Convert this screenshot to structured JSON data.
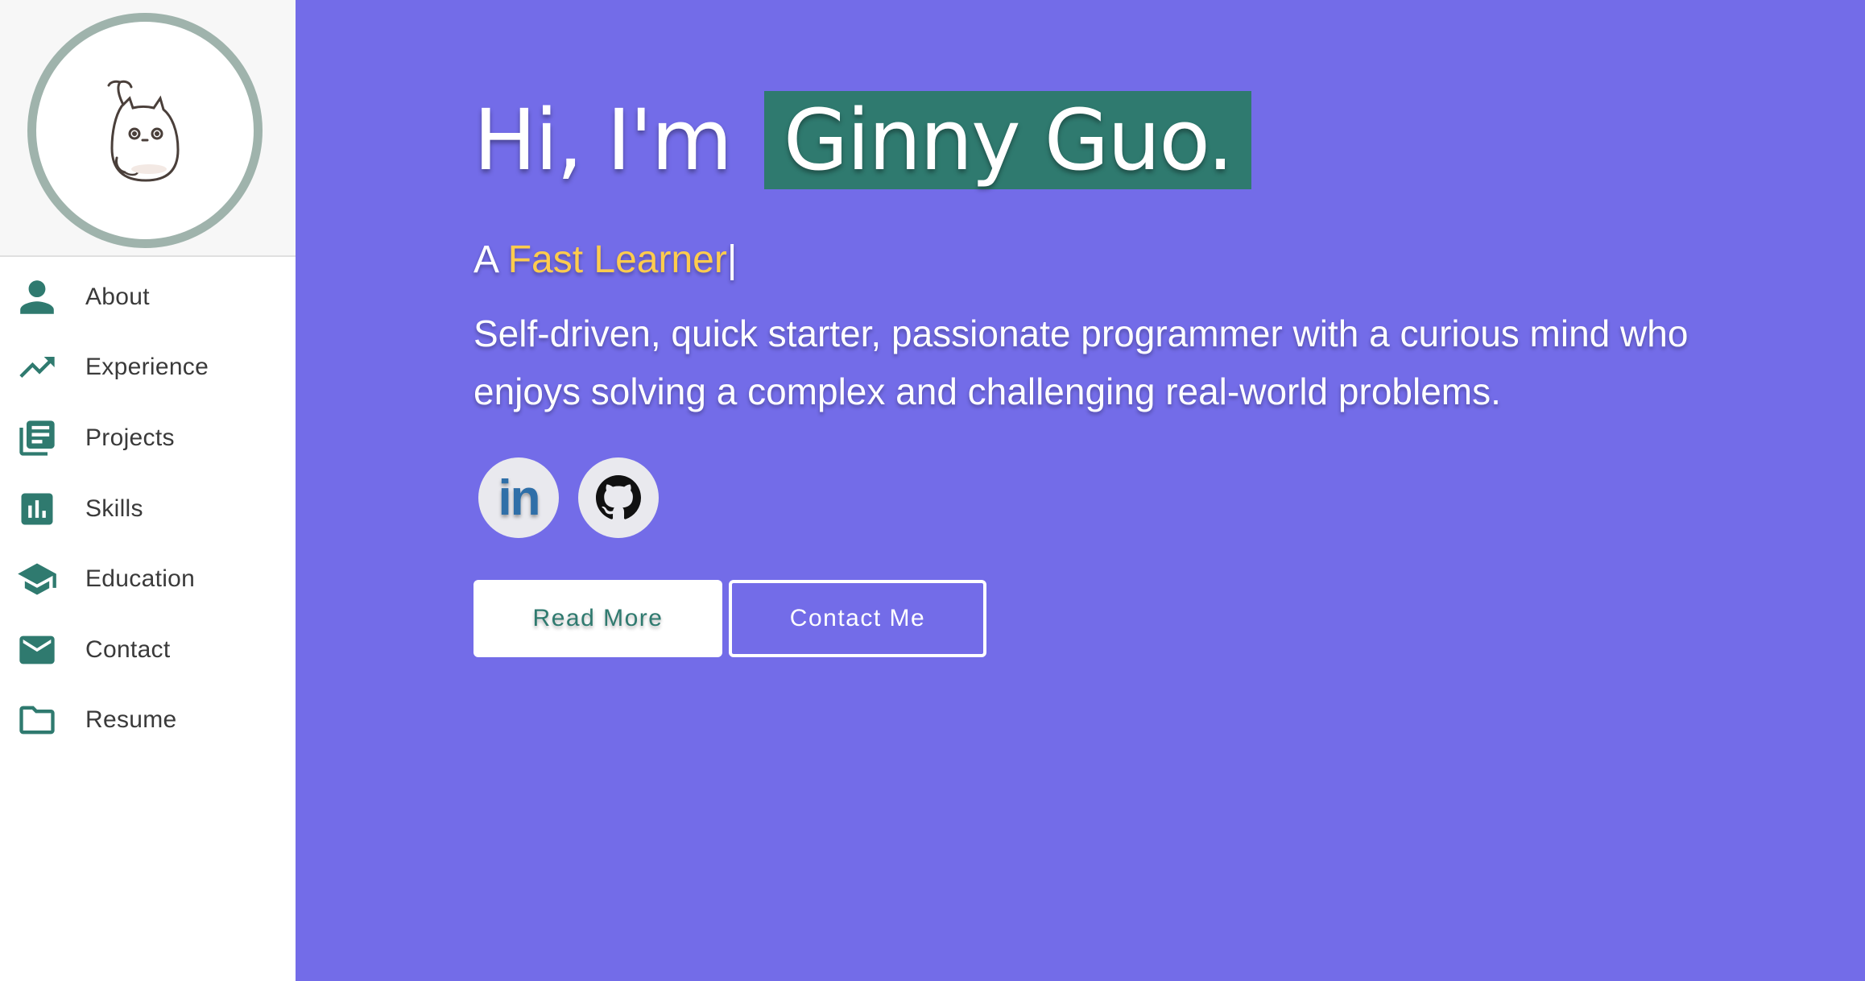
{
  "sidebar": {
    "avatar": {
      "icon": "totoro-sprout-icon"
    },
    "items": [
      {
        "label": "About",
        "icon": "person-icon"
      },
      {
        "label": "Experience",
        "icon": "trending-up-icon"
      },
      {
        "label": "Projects",
        "icon": "library-books-icon"
      },
      {
        "label": "Skills",
        "icon": "bar-chart-icon"
      },
      {
        "label": "Education",
        "icon": "graduation-cap-icon"
      },
      {
        "label": "Contact",
        "icon": "mail-icon"
      },
      {
        "label": "Resume",
        "icon": "folder-icon"
      }
    ]
  },
  "hero": {
    "greeting": "Hi, I'm",
    "name": "Ginny Guo.",
    "subtitle_prefix": "A",
    "subtitle_accent": "Fast Learner",
    "subtitle_cursor": "|",
    "description": "Self-driven, quick starter, passionate programmer with a curious mind who enjoys solving a complex and challenging real-world problems.",
    "social": [
      {
        "label": "in",
        "icon": "linkedin-icon"
      },
      {
        "label": "",
        "icon": "github-icon"
      }
    ],
    "buttons": {
      "read_more": "Read More",
      "contact_me": "Contact Me"
    }
  },
  "colors": {
    "main_background": "#736ce8",
    "accent_green": "#2f7a6f",
    "accent_yellow": "#ffcc4d",
    "avatar_ring": "#9fb3ac"
  }
}
